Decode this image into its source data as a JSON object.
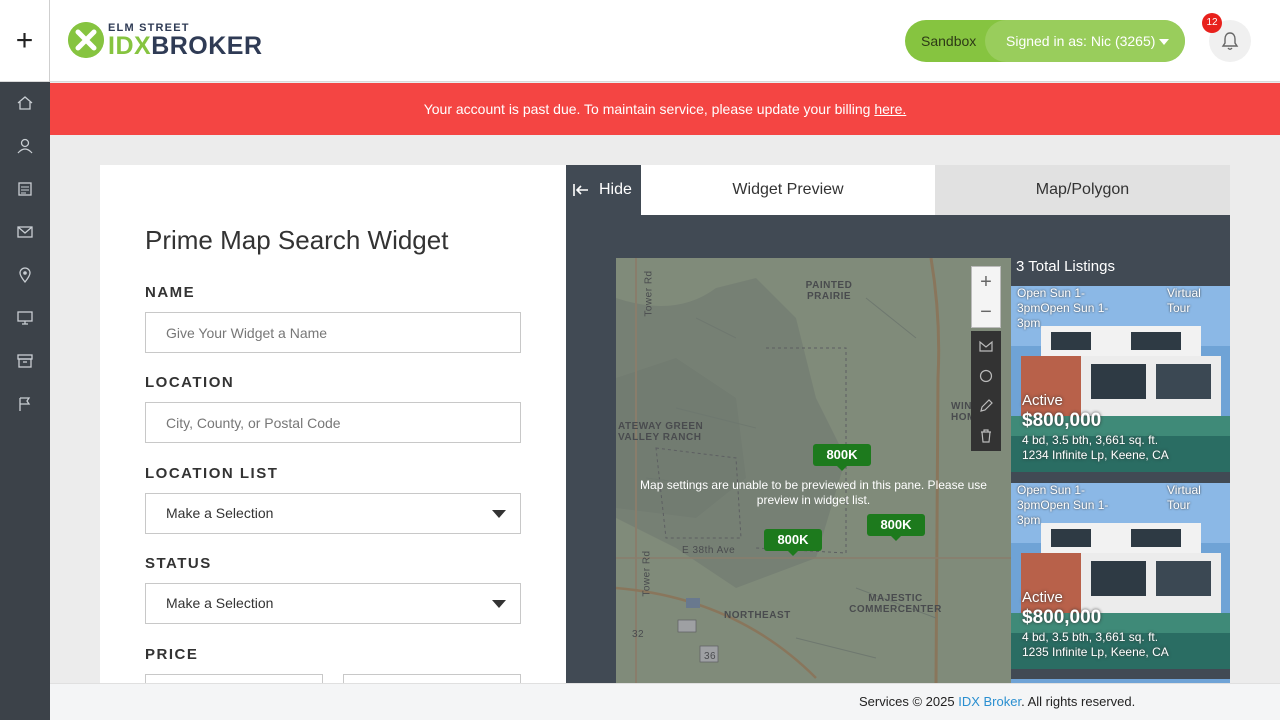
{
  "header": {
    "logo_top": "ELM STREET",
    "logo_idx": "IDX",
    "logo_broker": "BROKER",
    "environment": "Sandbox",
    "signed_in": "Signed in as: Nic (3265)",
    "notification_count": "12"
  },
  "alert": {
    "message": "Your account is past due. To maintain service, please update your billing",
    "link": "here."
  },
  "sidebar": {
    "icons": [
      "home-icon",
      "user-icon",
      "listings-icon",
      "mail-icon",
      "map-pin-icon",
      "monitor-icon",
      "archive-icon",
      "flag-icon"
    ]
  },
  "form": {
    "title": "Prime Map Search Widget",
    "name_label": "NAME",
    "name_placeholder": "Give Your Widget a Name",
    "location_label": "LOCATION",
    "location_placeholder": "City, County, or Postal Code",
    "location_list_label": "LOCATION LIST",
    "location_list_value": "Make a Selection",
    "status_label": "STATUS",
    "status_value": "Make a Selection",
    "price_label": "PRICE"
  },
  "preview": {
    "hide_label": "Hide",
    "tab_widget": "Widget Preview",
    "tab_map": "Map/Polygon",
    "map_message": "Map settings are unable to be previewed in this pane. Please use preview in widget list.",
    "markers": [
      "800K",
      "800K",
      "800K"
    ],
    "map_labels": {
      "painted_prairie": "PAINTED PRAIRIE",
      "gateway": "ATEWAY GREEN VALLEY RANCH",
      "northeast": "NORTHEAST",
      "majestic": "MAJESTIC COMMERCENTER",
      "e38th": "E 38th Ave",
      "tower_rd": "Tower Rd",
      "tower_rd2": "Tower Rd",
      "winhome": "WIN HOME",
      "hwy32": "32",
      "hwy36": "36"
    },
    "zoom_in": "+",
    "zoom_out": "−",
    "total_listings": "3 Total Listings",
    "listings": [
      {
        "open": "Open Sun 1-3pmOpen Sun 1-3pm",
        "tour": "Virtual Tour",
        "status": "Active",
        "price": "$800,000",
        "details": "4 bd, 3.5 bth, 3,661 sq. ft.",
        "address": "1234 Infinite Lp, Keene, CA"
      },
      {
        "open": "Open Sun 1-3pmOpen Sun 1-3pm",
        "tour": "Virtual Tour",
        "status": "Active",
        "price": "$800,000",
        "details": "4 bd, 3.5 bth, 3,661 sq. ft.",
        "address": "1235 Infinite Lp, Keene, CA"
      }
    ]
  },
  "footer": {
    "prefix": "Services © 2025",
    "link": "IDX Broker",
    "suffix": ". All rights reserved."
  },
  "colors": {
    "brand_green": "#86c440",
    "alert_red": "#f44543",
    "sidebar": "#3c4249",
    "preview_bg": "#414a54",
    "marker_green": "#1d7a1d"
  }
}
